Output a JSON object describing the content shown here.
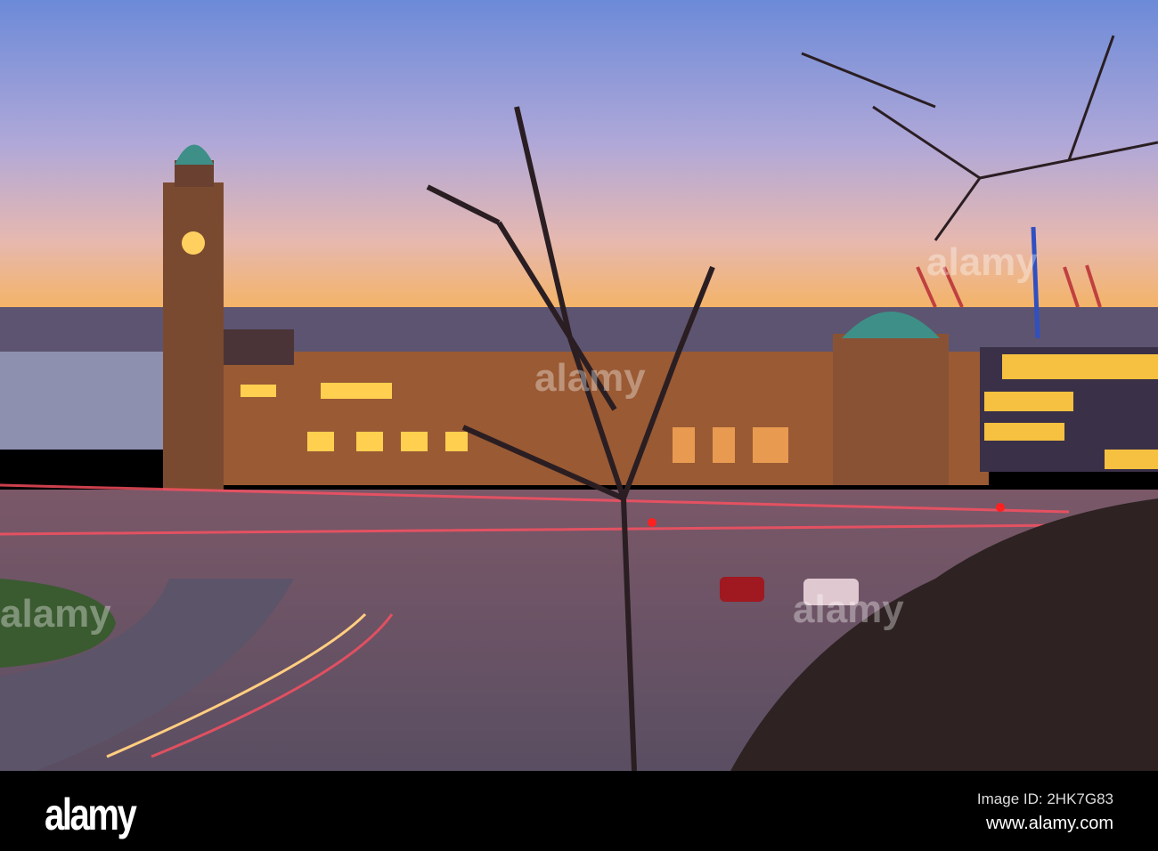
{
  "watermark": "alamy",
  "footer": {
    "logo": "alamy",
    "image_id": "Image ID: 2HK7G83",
    "url": "www.alamy.com"
  },
  "colors": {
    "sky_top": "#6c8ad8",
    "horizon": "#f7b35a",
    "building": "#9a5a34",
    "road": "#6a5060",
    "lights": "#ffcf50"
  }
}
